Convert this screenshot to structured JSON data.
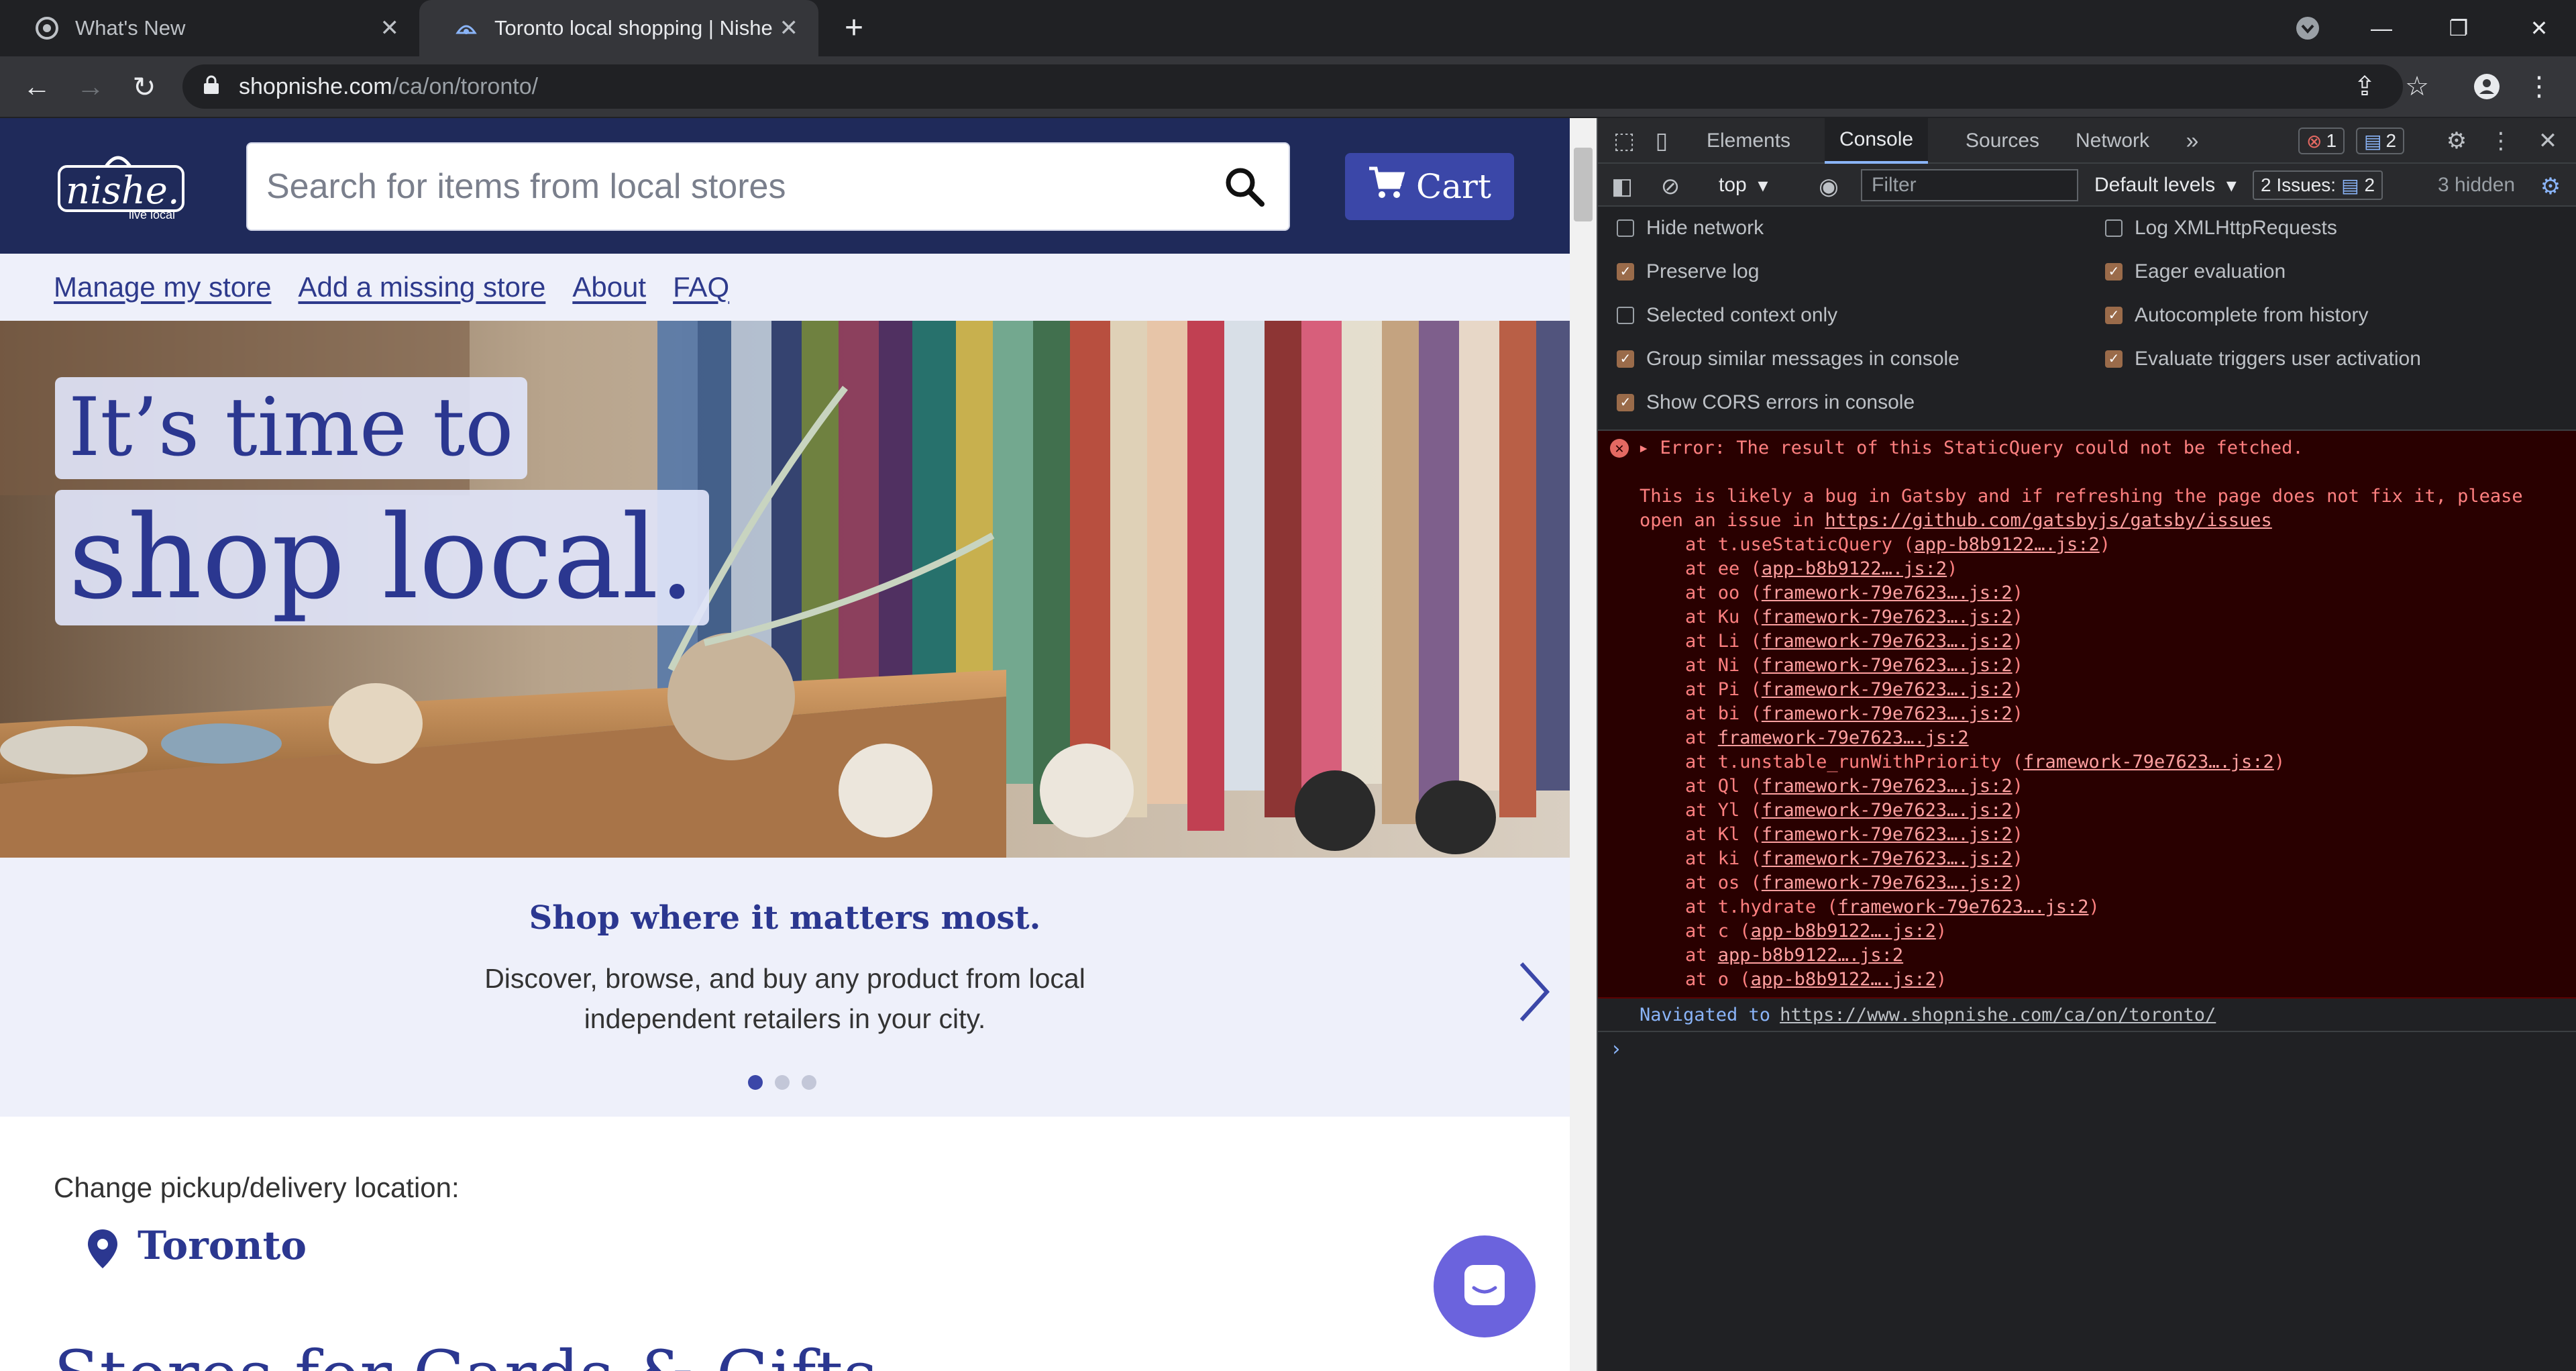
{
  "browser": {
    "tabs": [
      {
        "title": "What's New",
        "active": false
      },
      {
        "title": "Toronto local shopping | Nishe",
        "active": true
      }
    ],
    "url_host": "shopnishe.com",
    "url_path": "/ca/on/toronto/"
  },
  "site": {
    "logo_text": "nishe.",
    "logo_tagline": "live local",
    "search_placeholder": "Search for items from local stores",
    "cart_label": "Cart",
    "subnav": [
      "Manage my store",
      "Add a missing store",
      "About",
      "FAQ"
    ],
    "hero_line1": "It’s time to",
    "hero_line2": "shop local.",
    "carousel": {
      "title": "Shop where it matters most.",
      "text": "Discover, browse, and buy any product from local independent retailers in your city.",
      "slide_count": 3,
      "active_slide": 1
    },
    "location_label": "Change pickup/delivery location:",
    "location_city": "Toronto",
    "stores_heading": "Stores for Cards & Gifts"
  },
  "devtools": {
    "tabs": [
      "Elements",
      "Console",
      "Sources",
      "Network"
    ],
    "active_tab": "Console",
    "error_count": "1",
    "message_count": "2",
    "context": "top",
    "filter_placeholder": "Filter",
    "levels": "Default levels",
    "issues_label": "2 Issues:",
    "issues_count": "2",
    "hidden": "3 hidden",
    "settings": [
      {
        "label": "Hide network",
        "checked": false
      },
      {
        "label": "Log XMLHttpRequests",
        "checked": false
      },
      {
        "label": "Preserve log",
        "checked": true
      },
      {
        "label": "Eager evaluation",
        "checked": true
      },
      {
        "label": "Selected context only",
        "checked": false
      },
      {
        "label": "Autocomplete from history",
        "checked": true
      },
      {
        "label": "Group similar messages in console",
        "checked": true
      },
      {
        "label": "Evaluate triggers user activation",
        "checked": true
      },
      {
        "label": "Show CORS errors in console",
        "checked": true
      }
    ],
    "error_heading": "Error: The result of this StaticQuery could not be fetched.",
    "error_msg1": "This is likely a bug in Gatsby and if refreshing the page does not fix it, please",
    "error_msg2_prefix": "open an issue in ",
    "error_msg2_link": "https://github.com/gatsbyjs/gatsby/issues",
    "stack": [
      {
        "fn": "t.useStaticQuery",
        "src": "app-b8b9122….js:2"
      },
      {
        "fn": "ee",
        "src": "app-b8b9122….js:2"
      },
      {
        "fn": "oo",
        "src": "framework-79e7623….js:2"
      },
      {
        "fn": "Ku",
        "src": "framework-79e7623….js:2"
      },
      {
        "fn": "Li",
        "src": "framework-79e7623….js:2"
      },
      {
        "fn": "Ni",
        "src": "framework-79e7623….js:2"
      },
      {
        "fn": "Pi",
        "src": "framework-79e7623….js:2"
      },
      {
        "fn": "bi",
        "src": "framework-79e7623….js:2"
      },
      {
        "fn": "",
        "src": "framework-79e7623….js:2"
      },
      {
        "fn": "t.unstable_runWithPriority",
        "src": "framework-79e7623….js:2"
      },
      {
        "fn": "Ql",
        "src": "framework-79e7623….js:2"
      },
      {
        "fn": "Yl",
        "src": "framework-79e7623….js:2"
      },
      {
        "fn": "Kl",
        "src": "framework-79e7623….js:2"
      },
      {
        "fn": "ki",
        "src": "framework-79e7623….js:2"
      },
      {
        "fn": "os",
        "src": "framework-79e7623….js:2"
      },
      {
        "fn": "t.hydrate",
        "src": "framework-79e7623….js:2"
      },
      {
        "fn": "c",
        "src": "app-b8b9122….js:2"
      },
      {
        "fn": "",
        "src": "app-b8b9122….js:2"
      },
      {
        "fn": "o",
        "src": "app-b8b9122….js:2"
      }
    ],
    "navigated_label": "Navigated to",
    "navigated_url": "https://www.shopnishe.com/ca/on/toronto/"
  },
  "colors": {
    "site_navy": "#1f2a5a",
    "brand_blue": "#3b47a8",
    "error_bg": "#290000",
    "error_text": "#ff8080"
  }
}
